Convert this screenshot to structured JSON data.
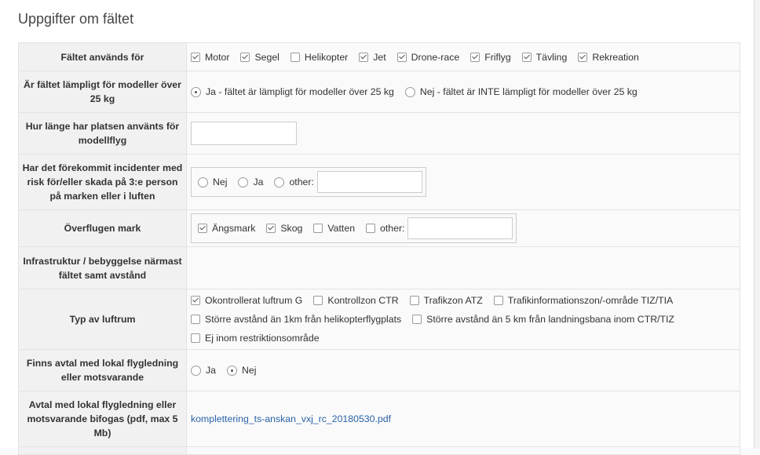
{
  "section": {
    "title": "Uppgifter om fältet"
  },
  "rows": {
    "usage": {
      "label": "Fältet används för",
      "options": [
        {
          "label": "Motor",
          "checked": true
        },
        {
          "label": "Segel",
          "checked": true
        },
        {
          "label": "Helikopter",
          "checked": false
        },
        {
          "label": "Jet",
          "checked": true
        },
        {
          "label": "Drone-race",
          "checked": true
        },
        {
          "label": "Friflyg",
          "checked": true
        },
        {
          "label": "Tävling",
          "checked": true
        },
        {
          "label": "Rekreation",
          "checked": true
        }
      ]
    },
    "heavy": {
      "label": "Är fältet lämpligt för modeller över 25 kg",
      "yes_label": "Ja - fältet är lämpligt för modeller över 25 kg",
      "no_label": "Nej - fältet är INTE lämpligt för modeller över 25 kg",
      "selected": "yes"
    },
    "duration": {
      "label": "Hur länge har platsen använts för modellflyg",
      "value": ""
    },
    "incidents": {
      "label": "Har det förekommit incidenter med risk för/eller skada på 3:e person på marken eller i luften",
      "no_label": "Nej",
      "yes_label": "Ja",
      "other_label": "other:",
      "other_value": ""
    },
    "overflown": {
      "label": "Överflugen mark",
      "options": [
        {
          "label": "Ängsmark",
          "checked": true
        },
        {
          "label": "Skog",
          "checked": true
        },
        {
          "label": "Vatten",
          "checked": false
        }
      ],
      "other_label": "other:",
      "other_value": ""
    },
    "infra": {
      "label": "Infrastruktur / bebyggelse närmast fältet samt avstånd",
      "value": ""
    },
    "airspace": {
      "label": "Typ av luftrum",
      "options": [
        {
          "label": "Okontrollerat luftrum G",
          "checked": true
        },
        {
          "label": "Kontrollzon CTR",
          "checked": false
        },
        {
          "label": "Trafikzon ATZ",
          "checked": false
        },
        {
          "label": "Trafikinformationszon/-område TIZ/TIA",
          "checked": false
        },
        {
          "label": "Större avstånd än 1km från helikopterflygplats",
          "checked": false
        },
        {
          "label": "Större avstånd än 5 km från landningsbana inom CTR/TIZ",
          "checked": false
        },
        {
          "label": "Ej inom restriktionsområde",
          "checked": false
        }
      ]
    },
    "atc_agreement": {
      "label": "Finns avtal med lokal flygledning eller motsvarande",
      "yes_label": "Ja",
      "no_label": "Nej",
      "selected": "no"
    },
    "agreement_file": {
      "label": "Avtal med lokal flygledning eller motsvarande bifogas (pdf, max 5 Mb)",
      "file_name": "komplettering_ts-anskan_vxj_rc_20180530.pdf"
    }
  }
}
